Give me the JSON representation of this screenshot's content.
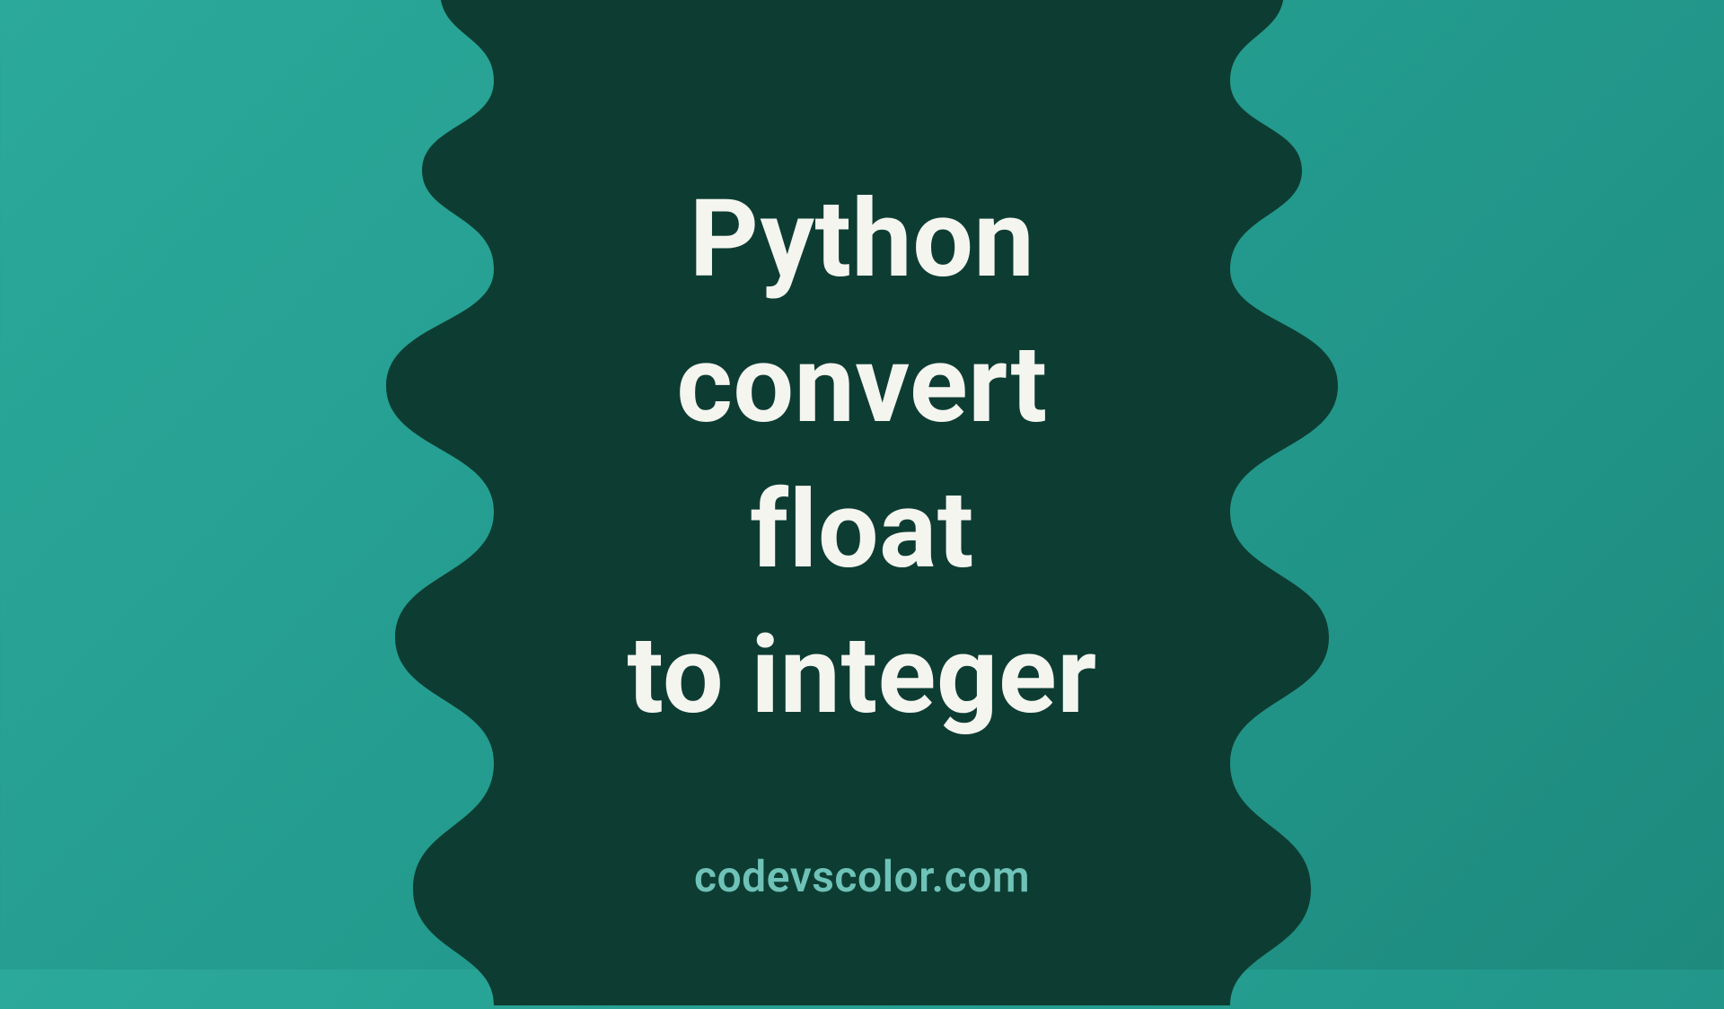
{
  "title": {
    "line1": "Python",
    "line2": "convert",
    "line3": "float",
    "line4": "to integer"
  },
  "site_name": "codevscolor.com",
  "colors": {
    "blob_fill": "#0d3d32",
    "bg_gradient_start": "#2ba99a",
    "bg_gradient_end": "#1e8a7e",
    "title_color": "#f5f5f0",
    "site_name_color": "#6fc2b8"
  }
}
